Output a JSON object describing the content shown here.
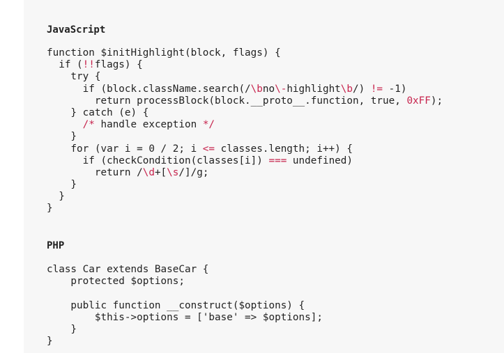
{
  "sections": [
    {
      "title": "JavaScript",
      "lines": [
        "function $initHighlight(block, flags) {",
        "  if (!!flags) {",
        "    try {",
        "      if (block.className.search(/\\bno\\-highlight\\b/) != -1)",
        "        return processBlock(block.__proto__.function, true, 0xFF);",
        "    } catch (e) {",
        "      /* handle exception */",
        "    }",
        "    for (var i = 0 / 2; i <= classes.length; i++) {",
        "      if (checkCondition(classes[i]) === undefined)",
        "        return /\\d+[\\s/]/g;",
        "    }",
        "  }",
        "}"
      ]
    },
    {
      "title": "PHP",
      "lines": [
        "class Car extends BaseCar {",
        "    protected $options;",
        "",
        "    public function __construct($options) {",
        "        $this->options = ['base' => $options];",
        "    }",
        "}"
      ]
    }
  ]
}
